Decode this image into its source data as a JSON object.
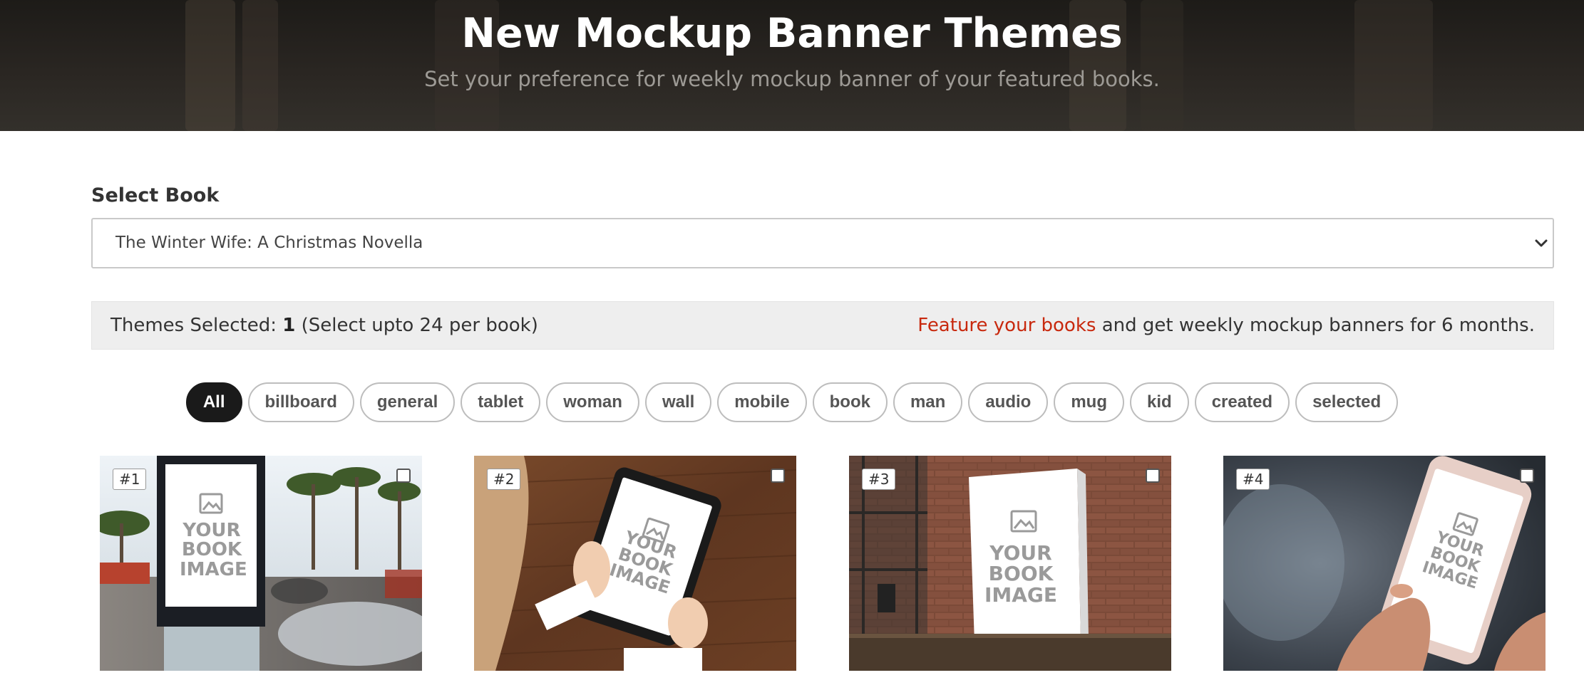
{
  "header": {
    "title": "New Mockup Banner Themes",
    "subtitle": "Set your preference for weekly mockup banner of your featured books."
  },
  "select_book": {
    "label": "Select Book",
    "value": "The Winter Wife: A Christmas Novella"
  },
  "info_bar": {
    "selected_prefix": "Themes Selected:",
    "selected_count": "1",
    "selected_suffix": "(Select upto 24 per book)",
    "feature_link": "Feature your books",
    "feature_text": "and get weekly mockup banners for 6 months."
  },
  "filters": [
    "All",
    "billboard",
    "general",
    "tablet",
    "woman",
    "wall",
    "mobile",
    "book",
    "man",
    "audio",
    "mug",
    "kid",
    "created",
    "selected"
  ],
  "active_filter": "All",
  "cards": [
    {
      "number": "#1",
      "placeholder": "YOUR BOOK IMAGE",
      "checked": false
    },
    {
      "number": "#2",
      "placeholder": "YOUR BOOK IMAGE",
      "checked": false
    },
    {
      "number": "#3",
      "placeholder": "YOUR BOOK IMAGE",
      "checked": false
    },
    {
      "number": "#4",
      "placeholder": "YOUR BOOK IMAGE",
      "checked": false
    }
  ],
  "colors": {
    "accent_link": "#c8290e",
    "active_pill": "#1a1a1a",
    "hero_bg": "#2a2622"
  }
}
